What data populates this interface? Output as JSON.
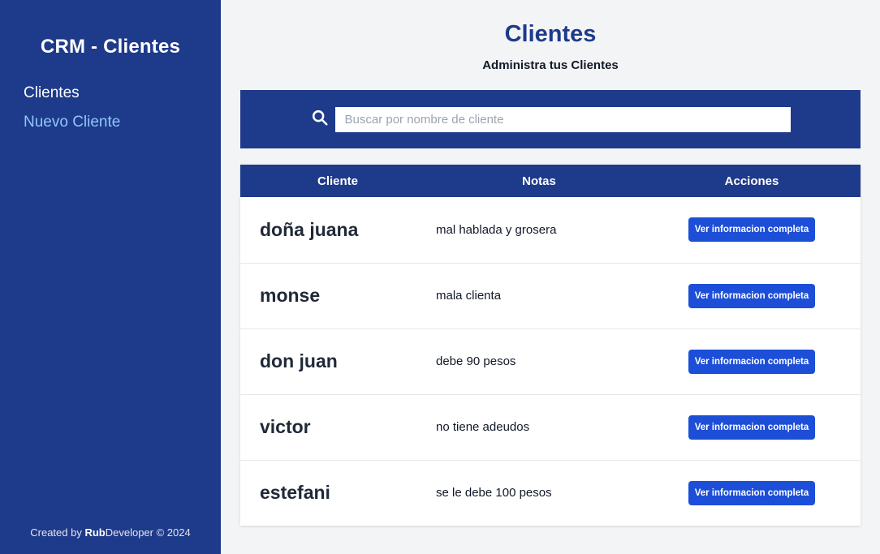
{
  "sidebar": {
    "brand": "CRM - Clientes",
    "nav": [
      "Clientes",
      "Nuevo Cliente"
    ],
    "footer_prefix": "Created by ",
    "footer_brand_bold": "Rub",
    "footer_brand_rest": "Developer",
    "footer_suffix": " © 2024"
  },
  "header": {
    "title": "Clientes",
    "subtitle": "Administra tus Clientes"
  },
  "search": {
    "placeholder": "Buscar por nombre de cliente",
    "value": ""
  },
  "table": {
    "columns": [
      "Cliente",
      "Notas",
      "Acciones"
    ],
    "rows": [
      {
        "name": "doña juana",
        "notes": "mal hablada y grosera",
        "action": "Ver informacion completa"
      },
      {
        "name": "monse",
        "notes": "mala clienta",
        "action": "Ver informacion completa"
      },
      {
        "name": "don juan",
        "notes": "debe 90 pesos",
        "action": "Ver informacion completa"
      },
      {
        "name": "victor",
        "notes": "no tiene adeudos",
        "action": "Ver informacion completa"
      },
      {
        "name": "estefani",
        "notes": "se le debe 100 pesos",
        "action": "Ver informacion completa"
      }
    ]
  },
  "colors": {
    "primary": "#1e3a8a",
    "button": "#1d4ed8",
    "nav_active": "#93c5fd",
    "background": "#f3f4f6"
  },
  "icons": {
    "search": "search-icon"
  }
}
